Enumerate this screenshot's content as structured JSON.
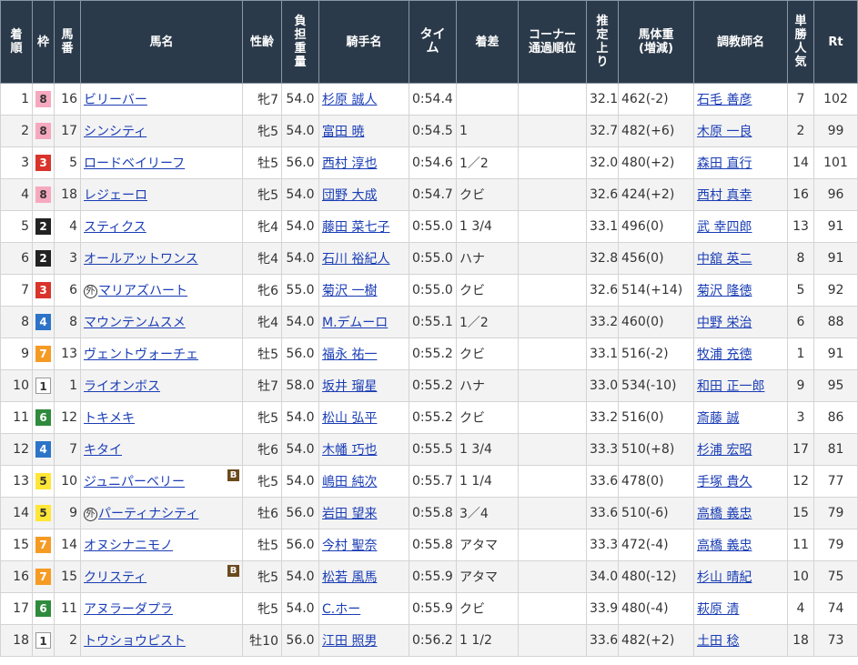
{
  "headers": {
    "rank": [
      "着",
      "順"
    ],
    "waku": [
      "枠"
    ],
    "num": [
      "馬",
      "番"
    ],
    "horse": [
      "馬名"
    ],
    "sexage": [
      "性齢"
    ],
    "weight": [
      "負",
      "担",
      "重",
      "量"
    ],
    "jockey": [
      "騎手名"
    ],
    "time": [
      "タイ",
      "ム"
    ],
    "margin": [
      "着差"
    ],
    "corner": [
      "コーナー",
      "通過順位"
    ],
    "last3f": [
      "推",
      "定",
      "上",
      "り"
    ],
    "body": [
      "馬体重",
      "(増減)"
    ],
    "trainer": [
      "調教師名"
    ],
    "pop": [
      "単",
      "勝",
      "人",
      "気"
    ],
    "rt": [
      "Rt"
    ]
  },
  "rows": [
    {
      "rank": "1",
      "waku": "8",
      "num": "16",
      "gaiji": "",
      "horse": "ビリーバー",
      "blinker": "",
      "sexage": "牝7",
      "weight": "54.0",
      "jockey": "杉原 誠人",
      "time": "0:54.4",
      "margin": "",
      "corner": "",
      "last3f": "32.1",
      "body": "462(-2)",
      "trainer": "石毛 善彦",
      "pop": "7",
      "rt": "102"
    },
    {
      "rank": "2",
      "waku": "8",
      "num": "17",
      "gaiji": "",
      "horse": "シンシティ",
      "blinker": "",
      "sexage": "牝5",
      "weight": "54.0",
      "jockey": "富田 暁",
      "time": "0:54.5",
      "margin": "1",
      "corner": "",
      "last3f": "32.7",
      "body": "482(+6)",
      "trainer": "木原 一良",
      "pop": "2",
      "rt": "99"
    },
    {
      "rank": "3",
      "waku": "3",
      "num": "5",
      "gaiji": "",
      "horse": "ロードベイリーフ",
      "blinker": "",
      "sexage": "牡5",
      "weight": "56.0",
      "jockey": "西村 淳也",
      "time": "0:54.6",
      "margin": "1／2",
      "corner": "",
      "last3f": "32.0",
      "body": "480(+2)",
      "trainer": "森田 直行",
      "pop": "14",
      "rt": "101"
    },
    {
      "rank": "4",
      "waku": "8",
      "num": "18",
      "gaiji": "",
      "horse": "レジェーロ",
      "blinker": "",
      "sexage": "牝5",
      "weight": "54.0",
      "jockey": "団野 大成",
      "time": "0:54.7",
      "margin": "クビ",
      "corner": "",
      "last3f": "32.6",
      "body": "424(+2)",
      "trainer": "西村 真幸",
      "pop": "16",
      "rt": "96"
    },
    {
      "rank": "5",
      "waku": "2",
      "num": "4",
      "gaiji": "",
      "horse": "スティクス",
      "blinker": "",
      "sexage": "牝4",
      "weight": "54.0",
      "jockey": "藤田 菜七子",
      "time": "0:55.0",
      "margin": "1 3/4",
      "corner": "",
      "last3f": "33.1",
      "body": "496(0)",
      "trainer": "武 幸四郎",
      "pop": "13",
      "rt": "91"
    },
    {
      "rank": "6",
      "waku": "2",
      "num": "3",
      "gaiji": "",
      "horse": "オールアットワンス",
      "blinker": "",
      "sexage": "牝4",
      "weight": "54.0",
      "jockey": "石川 裕紀人",
      "time": "0:55.0",
      "margin": "ハナ",
      "corner": "",
      "last3f": "32.8",
      "body": "456(0)",
      "trainer": "中舘 英二",
      "pop": "8",
      "rt": "91"
    },
    {
      "rank": "7",
      "waku": "3",
      "num": "6",
      "gaiji": "外",
      "horse": "マリアズハート",
      "blinker": "",
      "sexage": "牝6",
      "weight": "55.0",
      "jockey": "菊沢 一樹",
      "time": "0:55.0",
      "margin": "クビ",
      "corner": "",
      "last3f": "32.6",
      "body": "514(+14)",
      "trainer": "菊沢 隆徳",
      "pop": "5",
      "rt": "92"
    },
    {
      "rank": "8",
      "waku": "4",
      "num": "8",
      "gaiji": "",
      "horse": "マウンテンムスメ",
      "blinker": "",
      "sexage": "牝4",
      "weight": "54.0",
      "jockey": "M.デムーロ",
      "time": "0:55.1",
      "margin": "1／2",
      "corner": "",
      "last3f": "33.2",
      "body": "460(0)",
      "trainer": "中野 栄治",
      "pop": "6",
      "rt": "88"
    },
    {
      "rank": "9",
      "waku": "7",
      "num": "13",
      "gaiji": "",
      "horse": "ヴェントヴォーチェ",
      "blinker": "",
      "sexage": "牡5",
      "weight": "56.0",
      "jockey": "福永 祐一",
      "time": "0:55.2",
      "margin": "クビ",
      "corner": "",
      "last3f": "33.1",
      "body": "516(-2)",
      "trainer": "牧浦 充徳",
      "pop": "1",
      "rt": "91"
    },
    {
      "rank": "10",
      "waku": "1",
      "num": "1",
      "gaiji": "",
      "horse": "ライオンボス",
      "blinker": "",
      "sexage": "牡7",
      "weight": "58.0",
      "jockey": "坂井 瑠星",
      "time": "0:55.2",
      "margin": "ハナ",
      "corner": "",
      "last3f": "33.0",
      "body": "534(-10)",
      "trainer": "和田 正一郎",
      "pop": "9",
      "rt": "95"
    },
    {
      "rank": "11",
      "waku": "6",
      "num": "12",
      "gaiji": "",
      "horse": "トキメキ",
      "blinker": "",
      "sexage": "牝5",
      "weight": "54.0",
      "jockey": "松山 弘平",
      "time": "0:55.2",
      "margin": "クビ",
      "corner": "",
      "last3f": "33.2",
      "body": "516(0)",
      "trainer": "斎藤 誠",
      "pop": "3",
      "rt": "86"
    },
    {
      "rank": "12",
      "waku": "4",
      "num": "7",
      "gaiji": "",
      "horse": "キタイ",
      "blinker": "",
      "sexage": "牝6",
      "weight": "54.0",
      "jockey": "木幡 巧也",
      "time": "0:55.5",
      "margin": "1 3/4",
      "corner": "",
      "last3f": "33.3",
      "body": "510(+8)",
      "trainer": "杉浦 宏昭",
      "pop": "17",
      "rt": "81"
    },
    {
      "rank": "13",
      "waku": "5",
      "num": "10",
      "gaiji": "",
      "horse": "ジュニパーベリー",
      "blinker": "B",
      "sexage": "牝5",
      "weight": "54.0",
      "jockey": "嶋田 純次",
      "time": "0:55.7",
      "margin": "1 1/4",
      "corner": "",
      "last3f": "33.6",
      "body": "478(0)",
      "trainer": "手塚 貴久",
      "pop": "12",
      "rt": "77"
    },
    {
      "rank": "14",
      "waku": "5",
      "num": "9",
      "gaiji": "外",
      "horse": "パーティナシティ",
      "blinker": "",
      "sexage": "牡6",
      "weight": "56.0",
      "jockey": "岩田 望来",
      "time": "0:55.8",
      "margin": "3／4",
      "corner": "",
      "last3f": "33.6",
      "body": "510(-6)",
      "trainer": "高橋 義忠",
      "pop": "15",
      "rt": "79"
    },
    {
      "rank": "15",
      "waku": "7",
      "num": "14",
      "gaiji": "",
      "horse": "オヌシナニモノ",
      "blinker": "",
      "sexage": "牡5",
      "weight": "56.0",
      "jockey": "今村 聖奈",
      "time": "0:55.8",
      "margin": "アタマ",
      "corner": "",
      "last3f": "33.3",
      "body": "472(-4)",
      "trainer": "高橋 義忠",
      "pop": "11",
      "rt": "79"
    },
    {
      "rank": "16",
      "waku": "7",
      "num": "15",
      "gaiji": "",
      "horse": "クリスティ",
      "blinker": "B",
      "sexage": "牝5",
      "weight": "54.0",
      "jockey": "松若 風馬",
      "time": "0:55.9",
      "margin": "アタマ",
      "corner": "",
      "last3f": "34.0",
      "body": "480(-12)",
      "trainer": "杉山 晴紀",
      "pop": "10",
      "rt": "75"
    },
    {
      "rank": "17",
      "waku": "6",
      "num": "11",
      "gaiji": "",
      "horse": "アヌラーダプラ",
      "blinker": "",
      "sexage": "牝5",
      "weight": "54.0",
      "jockey": "C.ホー",
      "time": "0:55.9",
      "margin": "クビ",
      "corner": "",
      "last3f": "33.9",
      "body": "480(-4)",
      "trainer": "萩原 清",
      "pop": "4",
      "rt": "74"
    },
    {
      "rank": "18",
      "waku": "1",
      "num": "2",
      "gaiji": "",
      "horse": "トウショウピスト",
      "blinker": "",
      "sexage": "牡10",
      "weight": "56.0",
      "jockey": "江田 照男",
      "time": "0:56.2",
      "margin": "1 1/2",
      "corner": "",
      "last3f": "33.6",
      "body": "482(+2)",
      "trainer": "土田 稔",
      "pop": "18",
      "rt": "73"
    }
  ]
}
